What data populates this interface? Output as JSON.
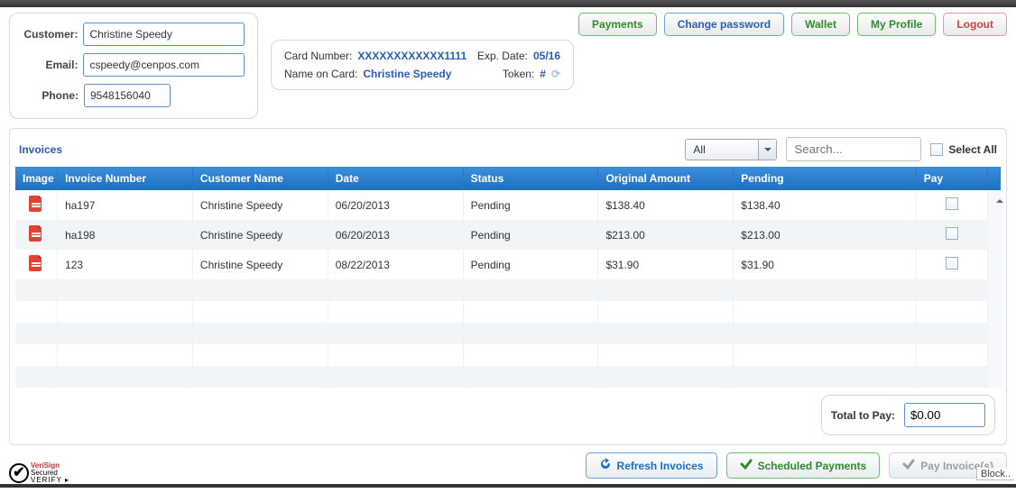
{
  "nav": {
    "payments": "Payments",
    "change_password": "Change password",
    "wallet": "Wallet",
    "my_profile": "My Profile",
    "logout": "Logout"
  },
  "customer": {
    "label_customer": "Customer:",
    "label_email": "Email:",
    "label_phone": "Phone:",
    "name": "Christine Speedy",
    "email": "cspeedy@cenpos.com",
    "phone": "9548156040"
  },
  "card": {
    "label_number": "Card Number:",
    "number": "XXXXXXXXXXXX1111",
    "label_exp": "Exp. Date:",
    "exp": "05/16",
    "label_name": "Name on Card:",
    "name": "Christine Speedy",
    "label_token": "Token:",
    "token": "#"
  },
  "invoices": {
    "title": "Invoices",
    "filter": "All",
    "search_placeholder": "Search...",
    "select_all": "Select All",
    "columns": {
      "image": "Image",
      "invoice_number": "Invoice Number",
      "customer_name": "Customer Name",
      "date": "Date",
      "status": "Status",
      "original_amount": "Original Amount",
      "pending": "Pending",
      "pay": "Pay"
    },
    "rows": [
      {
        "number": "ha197",
        "customer": "Christine Speedy",
        "date": "06/20/2013",
        "status": "Pending",
        "amount": "$138.40",
        "pending": "$138.40"
      },
      {
        "number": "ha198",
        "customer": "Christine Speedy",
        "date": "06/20/2013",
        "status": "Pending",
        "amount": "$213.00",
        "pending": "$213.00"
      },
      {
        "number": "123",
        "customer": "Christine Speedy",
        "date": "08/22/2013",
        "status": "Pending",
        "amount": "$31.90",
        "pending": "$31.90"
      }
    ]
  },
  "totals": {
    "label": "Total to Pay:",
    "value": "$0.00"
  },
  "actions": {
    "refresh": "Refresh Invoices",
    "scheduled": "Scheduled Payments",
    "pay": "Pay Invoice(s)"
  },
  "footer": {
    "block": "Block..",
    "verisign1": "VeriSign",
    "verisign2": "Secured",
    "verify": "VERIFY ▸"
  }
}
